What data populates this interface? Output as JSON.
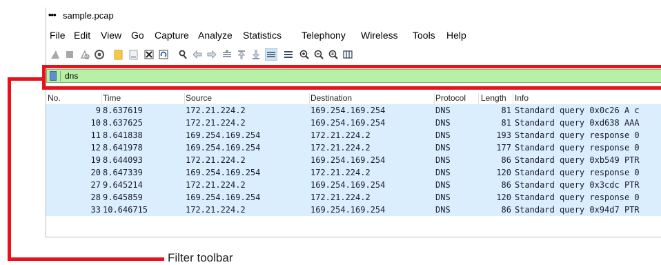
{
  "window": {
    "title": "sample.pcap"
  },
  "menu": [
    "File",
    "Edit",
    "View",
    "Go",
    "Capture",
    "Analyze",
    "Statistics",
    "Telephony",
    "Wireless",
    "Tools",
    "Help"
  ],
  "toolbar_icons": [
    "shark-fin-start-icon",
    "stop-capture-icon",
    "restart-capture-icon",
    "capture-options-icon",
    "open-file-icon",
    "save-file-icon",
    "close-file-icon",
    "reload-file-icon",
    "find-packet-icon",
    "go-back-icon",
    "go-forward-icon",
    "go-to-packet-icon",
    "first-packet-icon",
    "last-packet-icon",
    "autoscroll-icon",
    "colorize-icon",
    "zoom-in-icon",
    "zoom-out-icon",
    "normal-size-icon",
    "resize-columns-icon"
  ],
  "filter": {
    "value": "dns",
    "bg_color": "#b7f0a6"
  },
  "columns": [
    "No.",
    "Time",
    "Source",
    "Destination",
    "Protocol",
    "Length",
    "Info"
  ],
  "packets": [
    {
      "no": "9",
      "time": "8.637619",
      "source": "172.21.224.2",
      "destination": "169.254.169.254",
      "protocol": "DNS",
      "length": "81",
      "info": "Standard query 0x0c26 A c"
    },
    {
      "no": "10",
      "time": "8.637625",
      "source": "172.21.224.2",
      "destination": "169.254.169.254",
      "protocol": "DNS",
      "length": "81",
      "info": "Standard query 0xd638 AAA"
    },
    {
      "no": "11",
      "time": "8.641838",
      "source": "169.254.169.254",
      "destination": "172.21.224.2",
      "protocol": "DNS",
      "length": "193",
      "info": "Standard query response 0"
    },
    {
      "no": "12",
      "time": "8.641978",
      "source": "169.254.169.254",
      "destination": "172.21.224.2",
      "protocol": "DNS",
      "length": "177",
      "info": "Standard query response 0"
    },
    {
      "no": "19",
      "time": "8.644093",
      "source": "172.21.224.2",
      "destination": "169.254.169.254",
      "protocol": "DNS",
      "length": "86",
      "info": "Standard query 0xb549 PTR"
    },
    {
      "no": "20",
      "time": "8.647339",
      "source": "169.254.169.254",
      "destination": "172.21.224.2",
      "protocol": "DNS",
      "length": "120",
      "info": "Standard query response 0"
    },
    {
      "no": "27",
      "time": "9.645214",
      "source": "172.21.224.2",
      "destination": "169.254.169.254",
      "protocol": "DNS",
      "length": "86",
      "info": "Standard query 0x3cdc PTR"
    },
    {
      "no": "28",
      "time": "9.645859",
      "source": "169.254.169.254",
      "destination": "172.21.224.2",
      "protocol": "DNS",
      "length": "120",
      "info": "Standard query response 0"
    },
    {
      "no": "33",
      "time": "10.646715",
      "source": "172.21.224.2",
      "destination": "169.254.169.254",
      "protocol": "DNS",
      "length": "86",
      "info": "Standard query 0x94d7 PTR"
    }
  ],
  "row_color": "#daeefe",
  "annotation": {
    "label": "Filter toolbar",
    "color": "#e8121b"
  }
}
